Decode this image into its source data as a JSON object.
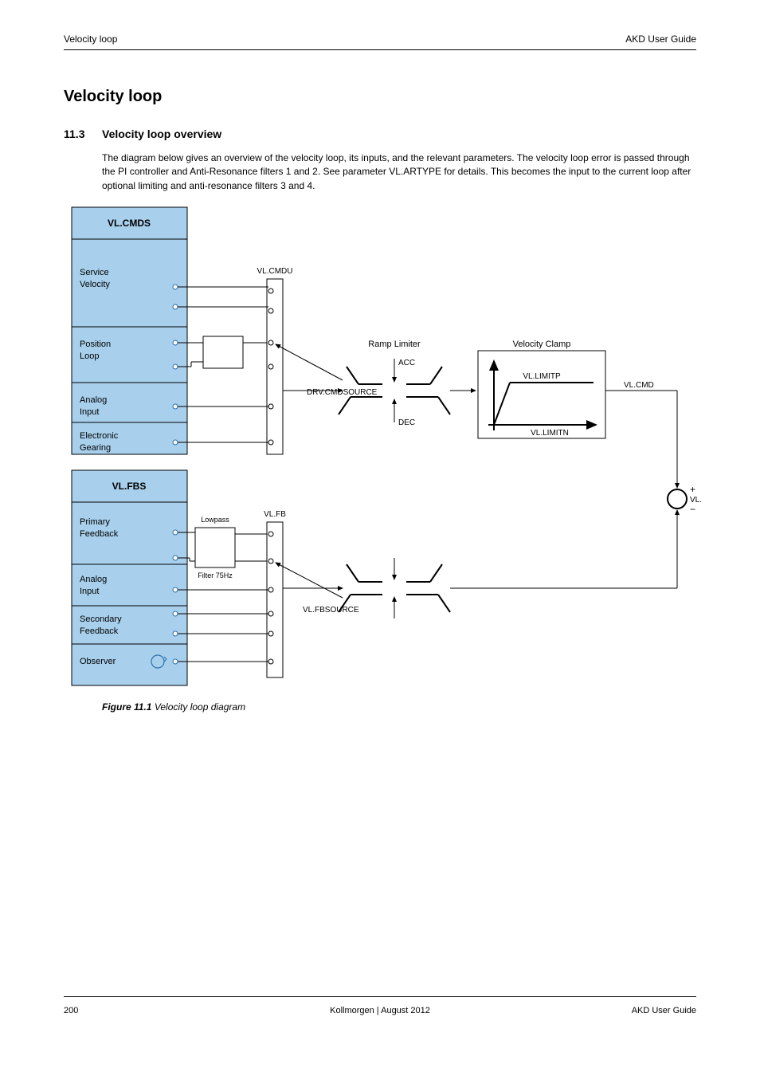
{
  "header": {
    "left": "Velocity loop",
    "right": "AKD User Guide"
  },
  "section": {
    "number": "11.3",
    "title": "Velocity loop overview"
  },
  "title": "Velocity loop",
  "intro": "The diagram below gives an overview of the velocity loop, its inputs, and the relevant parameters. The velocity loop error is passed through the PI controller and Anti-Resonance filters 1 and 2. See parameter VL.ARTYPE for details. This becomes the input to the current loop after optional limiting and anti-resonance filters 3 and 4.",
  "fig": {
    "num": "Figure 11.1",
    "caption": "Velocity loop diagram"
  },
  "blockA": {
    "title": "VL.CMDS",
    "r1": {
      "a": "Service",
      "b": "Velocity"
    },
    "r2": {
      "a": "Position",
      "b": "Loop"
    },
    "r3": {
      "a": "Analog",
      "b": "Input"
    },
    "r4": {
      "a": "Electronic",
      "b": "Gearing"
    }
  },
  "blockB": {
    "title": "VL.FBS",
    "r1": {
      "a": "Primary",
      "b": "Feedback"
    },
    "r2": {
      "a": "Analog",
      "b": "Input"
    },
    "r3": {
      "a": "Secondary",
      "b": "Feedback"
    },
    "r4": {
      "a": "Observer",
      "b": ""
    }
  },
  "mux": {
    "a": "VL.CMDU",
    "b": "VL.FB"
  },
  "ramp": {
    "title": "Ramp Limiter",
    "up": "ACC",
    "dn": "DEC"
  },
  "lim": {
    "title": "Velocity Clamp",
    "max": "VL.LIMITP",
    "min": "VL.LIMITN"
  },
  "sum": {
    "out": "VL.ERR"
  },
  "drvcmd": "DRV.CMDSOURCE",
  "vlfbsrc": "VL.FBSOURCE",
  "filt": {
    "a": "Lowpass",
    "b": "Filter 75Hz"
  },
  "footer": {
    "l": "200",
    "c": "Kollmorgen | August 2012",
    "r": "AKD User Guide"
  }
}
